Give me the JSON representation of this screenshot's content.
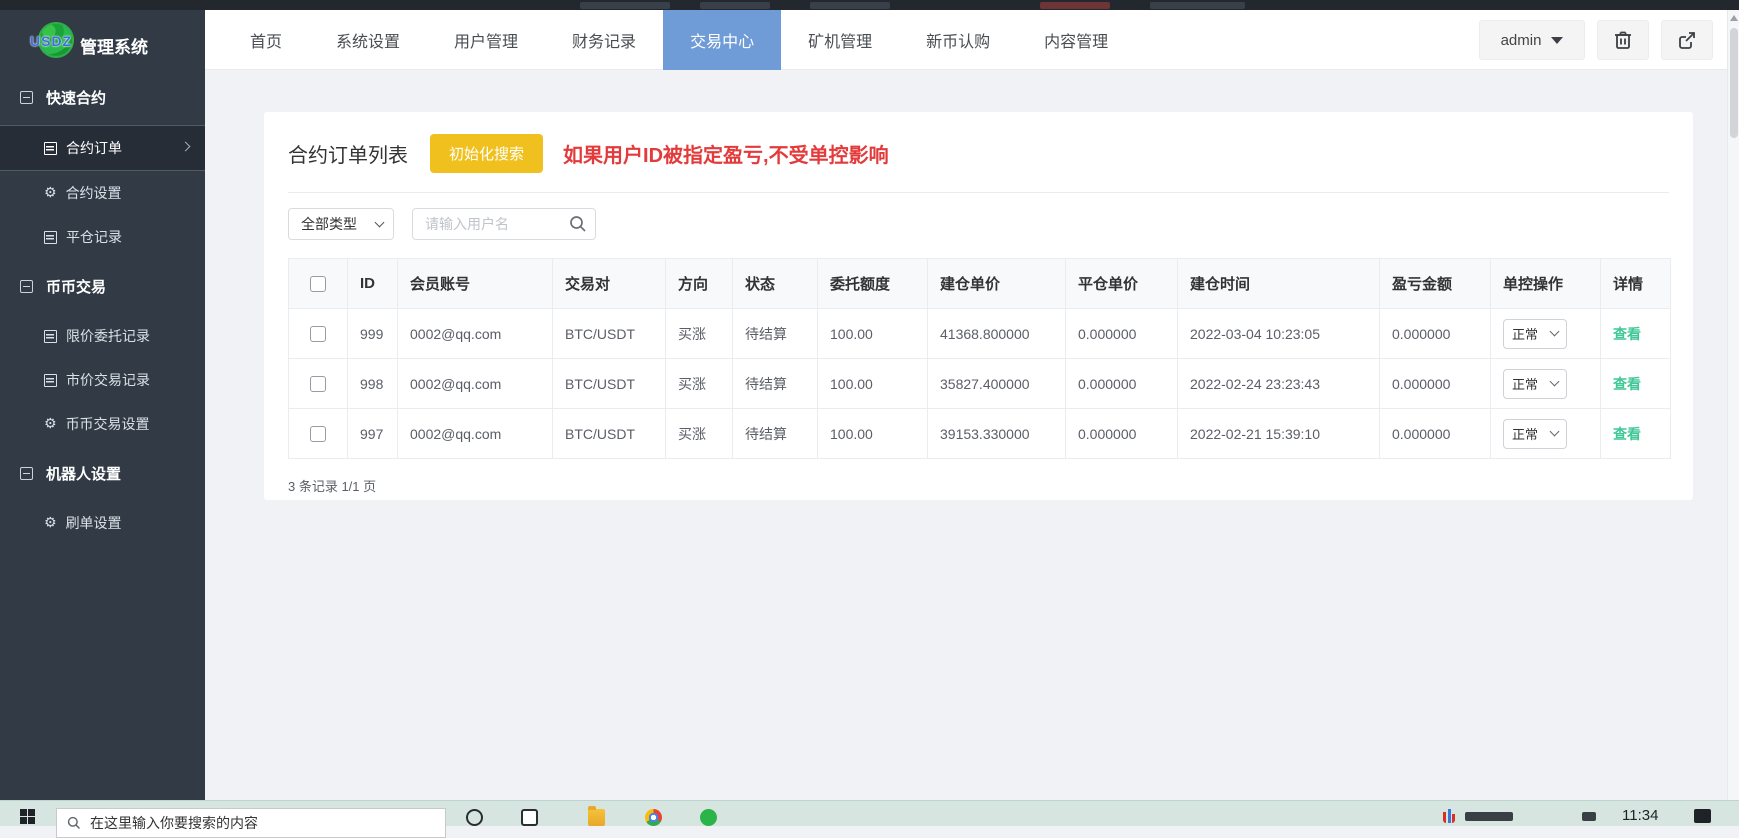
{
  "header": {
    "logo": {
      "brand": "USDZ",
      "title": "管理系统"
    },
    "nav": [
      {
        "label": "首页",
        "active": false
      },
      {
        "label": "系统设置",
        "active": false
      },
      {
        "label": "用户管理",
        "active": false
      },
      {
        "label": "财务记录",
        "active": false
      },
      {
        "label": "交易中心",
        "active": true
      },
      {
        "label": "矿机管理",
        "active": false
      },
      {
        "label": "新币认购",
        "active": false
      },
      {
        "label": "内容管理",
        "active": false
      }
    ],
    "user_menu": {
      "label": "admin"
    }
  },
  "sidebar": {
    "sections": [
      {
        "title": "快速合约",
        "items": [
          {
            "label": "合约订单",
            "icon": "list-icon",
            "active": true
          },
          {
            "label": "合约设置",
            "icon": "gear-icon",
            "active": false
          },
          {
            "label": "平仓记录",
            "icon": "list-icon",
            "active": false
          }
        ]
      },
      {
        "title": "币币交易",
        "items": [
          {
            "label": "限价委托记录",
            "icon": "list-icon",
            "active": false
          },
          {
            "label": "市价交易记录",
            "icon": "list-icon",
            "active": false
          },
          {
            "label": "币币交易设置",
            "icon": "gear-icon",
            "active": false
          }
        ]
      },
      {
        "title": "机器人设置",
        "items": [
          {
            "label": "刷单设置",
            "icon": "gear-icon",
            "active": false
          }
        ]
      }
    ]
  },
  "main": {
    "title": "合约订单列表",
    "init_search_button": "初始化搜索",
    "notice": "如果用户ID被指定盈亏,不受单控影响",
    "filters": {
      "type_select_value": "全部类型",
      "username_placeholder": "请输入用户名"
    },
    "table": {
      "columns": [
        "ID",
        "会员账号",
        "交易对",
        "方向",
        "状态",
        "委托额度",
        "建仓单价",
        "平仓单价",
        "建仓时间",
        "盈亏金额",
        "单控操作",
        "详情"
      ],
      "rows": [
        {
          "id": "999",
          "account": "0002@qq.com",
          "pair": "BTC/USDT",
          "direction": "买涨",
          "status": "待结算",
          "amount": "100.00",
          "open_price": "41368.800000",
          "close_price": "0.000000",
          "open_time": "2022-03-04 10:23:05",
          "profit": "0.000000",
          "control": "正常",
          "detail": "查看"
        },
        {
          "id": "998",
          "account": "0002@qq.com",
          "pair": "BTC/USDT",
          "direction": "买涨",
          "status": "待结算",
          "amount": "100.00",
          "open_price": "35827.400000",
          "close_price": "0.000000",
          "open_time": "2022-02-24 23:23:43",
          "profit": "0.000000",
          "control": "正常",
          "detail": "查看"
        },
        {
          "id": "997",
          "account": "0002@qq.com",
          "pair": "BTC/USDT",
          "direction": "买涨",
          "status": "待结算",
          "amount": "100.00",
          "open_price": "39153.330000",
          "close_price": "0.000000",
          "open_time": "2022-02-21 15:39:10",
          "profit": "0.000000",
          "control": "正常",
          "detail": "查看"
        }
      ]
    },
    "pagination": "3 条记录 1/1 页"
  },
  "taskbar": {
    "search_placeholder": "在这里输入你要搜索的内容",
    "time": "11:34"
  },
  "colors": {
    "nav_active_bg": "#6f9cd6",
    "button_yellow": "#f0c11e",
    "notice_red": "#e33b3b",
    "link_green": "#3fc796",
    "sidebar_bg": "#313a45"
  }
}
